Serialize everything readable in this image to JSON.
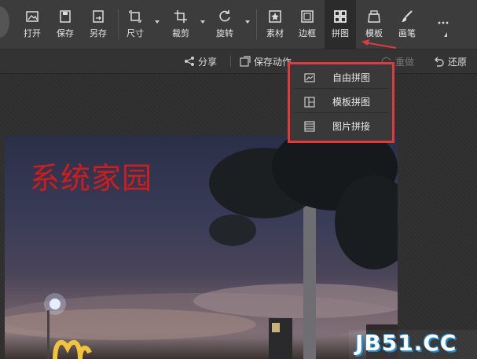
{
  "toolbar": {
    "open": "打开",
    "save": "保存",
    "save_as": "另存",
    "size": "尺寸",
    "crop": "裁剪",
    "rotate": "旋转",
    "material": "素材",
    "border": "边框",
    "collage": "拼图",
    "template": "模板",
    "brush": "画笔",
    "more_icon": "more-icon"
  },
  "subbar": {
    "share": "分享",
    "save_action": "保存动作",
    "redo": "重做",
    "restore": "还原"
  },
  "dropdown": {
    "items": [
      {
        "label": "自由拼图",
        "icon": "free-collage-icon"
      },
      {
        "label": "模板拼图",
        "icon": "template-collage-icon"
      },
      {
        "label": "图片拼接",
        "icon": "image-stitch-icon"
      }
    ]
  },
  "canvas": {
    "overlay_text": "系统家园"
  },
  "watermark": "JB51.CC",
  "colors": {
    "highlight_border": "#e23a3a",
    "overlay_text": "#d11c1c",
    "watermark_outline": "#1a8ad4"
  }
}
